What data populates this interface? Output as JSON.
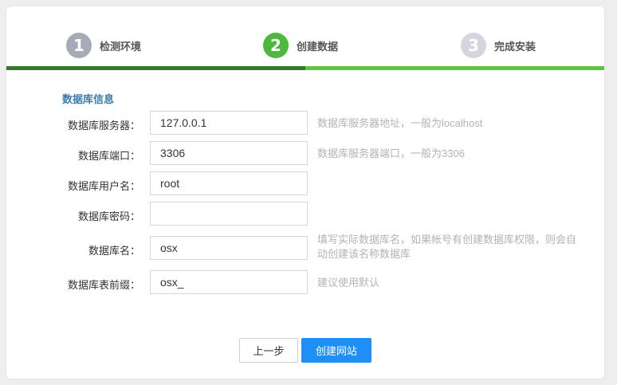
{
  "steps": [
    {
      "num": "1",
      "label": "检测环境"
    },
    {
      "num": "2",
      "label": "创建数据"
    },
    {
      "num": "3",
      "label": "完成安装"
    }
  ],
  "progress": {
    "completed_fraction": 0.5
  },
  "section_title": "数据库信息",
  "fields": {
    "server": {
      "label": "数据库服务器：",
      "value": "127.0.0.1",
      "hint": "数据库服务器地址，一般为localhost"
    },
    "port": {
      "label": "数据库端口：",
      "value": "3306",
      "hint": "数据库服务器端口，一般为3306"
    },
    "user": {
      "label": "数据库用户名：",
      "value": "root",
      "hint": ""
    },
    "password": {
      "label": "数据库密码：",
      "value": "",
      "hint": ""
    },
    "dbname": {
      "label": "数据库名：",
      "value": "osx",
      "hint": "填写实际数据库名，如果帐号有创建数据库权限，则会自动创建该名称数据库"
    },
    "prefix": {
      "label": "数据库表前缀：",
      "value": "osx_",
      "hint": "建议使用默认"
    }
  },
  "buttons": {
    "prev": "上一步",
    "create": "创建网站"
  },
  "colors": {
    "step1": "#a7abb7",
    "step2_active": "#4cb83c",
    "step3": "#d3d6de",
    "progress_done": "#2d7d28",
    "progress_todo": "#5fc43f",
    "section_title": "#3a7aa8",
    "primary_button": "#1e90f5"
  }
}
